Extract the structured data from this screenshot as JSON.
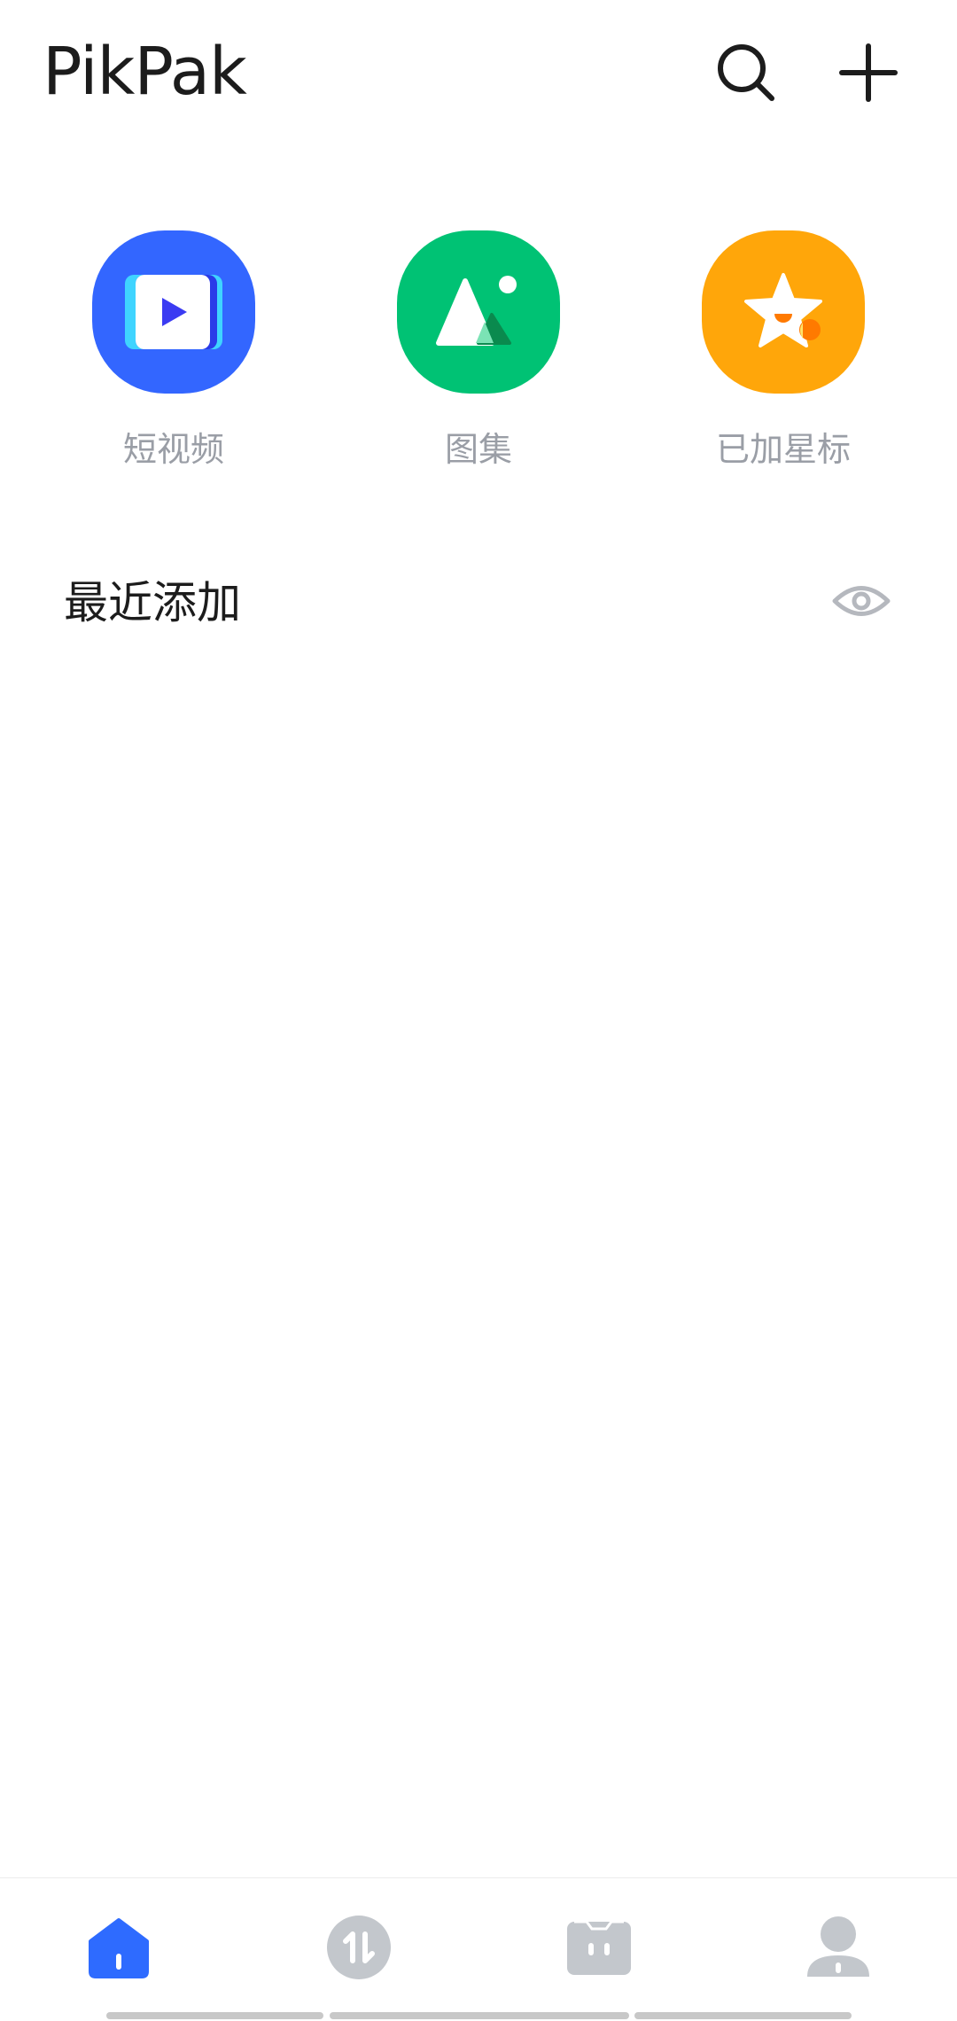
{
  "header": {
    "title": "PikPak"
  },
  "quick_access": [
    {
      "label": "短视频",
      "icon": "short-video-icon",
      "color": "#3366ff"
    },
    {
      "label": "图集",
      "icon": "gallery-icon",
      "color": "#00c274"
    },
    {
      "label": "已加星标",
      "icon": "star-icon",
      "color": "#ffa60a"
    }
  ],
  "recent": {
    "title": "最近添加",
    "icon": "eye-icon"
  },
  "bottom_nav": [
    {
      "name": "home",
      "icon": "home-icon",
      "active": true,
      "color": "#2e6bff"
    },
    {
      "name": "transfer",
      "icon": "transfer-icon",
      "active": false,
      "color": "#c3c7cc"
    },
    {
      "name": "box",
      "icon": "box-icon",
      "active": false,
      "color": "#c3c7cc"
    },
    {
      "name": "profile",
      "icon": "profile-icon",
      "active": false,
      "color": "#c3c7cc"
    }
  ]
}
